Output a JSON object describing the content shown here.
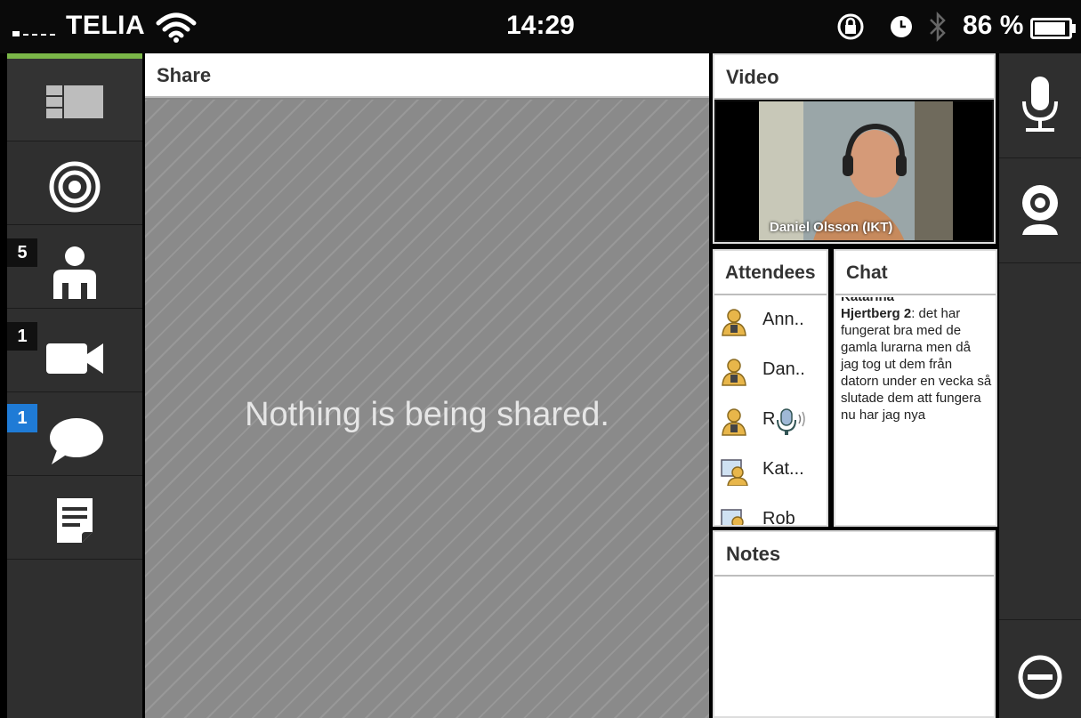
{
  "status_bar": {
    "carrier": "TELIA",
    "time": "14:29",
    "battery_percent": "86 %"
  },
  "sidebar": {
    "items": [
      {
        "name": "layouts",
        "icon": "layout-icon",
        "badge": null
      },
      {
        "name": "broadcast",
        "icon": "broadcast-icon",
        "badge": null
      },
      {
        "name": "attendees",
        "icon": "person-icon",
        "badge": "5"
      },
      {
        "name": "video",
        "icon": "video-camera-icon",
        "badge": "1"
      },
      {
        "name": "chat",
        "icon": "chat-bubble-icon",
        "badge": "1"
      },
      {
        "name": "notes",
        "icon": "notes-icon",
        "badge": null
      }
    ]
  },
  "share": {
    "title": "Share",
    "empty_message": "Nothing is being shared."
  },
  "video": {
    "title": "Video",
    "participant_name": "Daniel Olsson (IKT)"
  },
  "attendees": {
    "title": "Attendees",
    "list": [
      {
        "name": "Ann..",
        "role": "host"
      },
      {
        "name": "Dan..",
        "role": "host"
      },
      {
        "name": "R",
        "role": "host",
        "speaking": true
      },
      {
        "name": "Kat...",
        "role": "participant"
      },
      {
        "name": "Rob",
        "role": "participant"
      }
    ]
  },
  "chat": {
    "title": "Chat",
    "cut_line": "Katarina",
    "sender": "Hjertberg 2",
    "message": ": det har fungerat bra med de gamla lurarna men då jag tog ut dem från datorn under en vecka så slutade dem att fungera nu har jag nya"
  },
  "notes": {
    "title": "Notes"
  },
  "right_controls": {
    "items": [
      {
        "name": "microphone",
        "icon": "microphone-icon"
      },
      {
        "name": "webcam",
        "icon": "webcam-icon"
      },
      {
        "name": "leave",
        "icon": "minus-circle-icon"
      }
    ]
  },
  "colors": {
    "accent": "#7ab648",
    "badge_blue": "#1f7bd6",
    "sidebar": "#2f2f2f"
  }
}
